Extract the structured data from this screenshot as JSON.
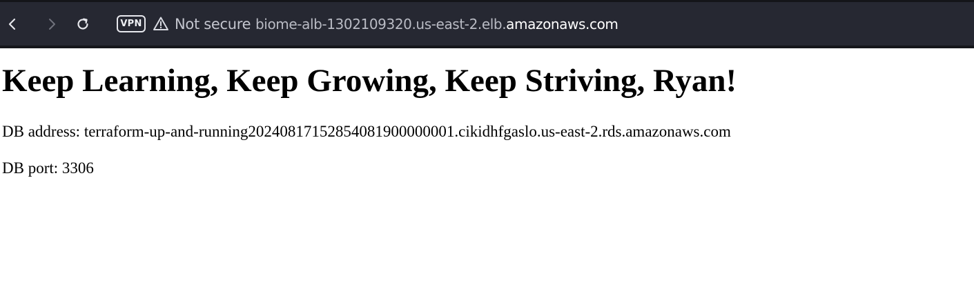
{
  "browser": {
    "security_label": "Not secure",
    "vpn_label": "VPN",
    "url_subdomain": "biome-alb-1302109320.us-east-2.elb.",
    "url_domain": "amazonaws.com",
    "icons": {
      "back": "back-arrow-icon",
      "forward": "forward-arrow-icon",
      "reload": "reload-icon",
      "warning": "warning-triangle-icon"
    },
    "colors": {
      "toolbar_bg": "#262832",
      "toolbar_text": "#ffffff",
      "muted_text": "#b9bbc4"
    }
  },
  "page": {
    "heading": "Keep Learning, Keep Growing, Keep Striving, Ryan!",
    "db_address_text": "DB address: terraform-up-and-running20240817152854081900000001.cikidhfgaslo.us-east-2.rds.amazonaws.com",
    "db_port_text": "DB port: 3306"
  }
}
